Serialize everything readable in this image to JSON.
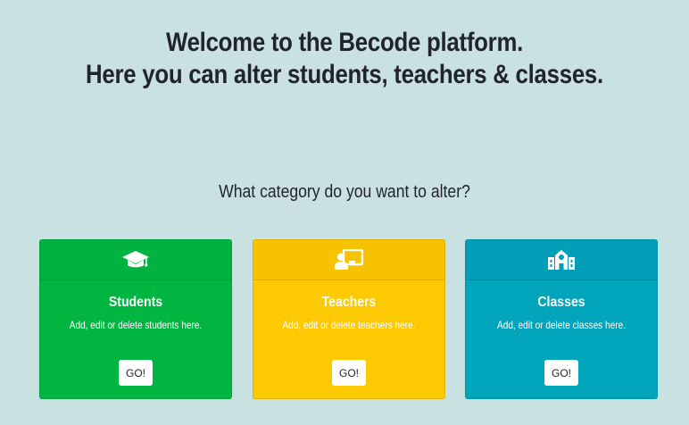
{
  "heading": {
    "line1": "Welcome to the Becode platform.",
    "line2": "Here you can alter students, teachers & classes."
  },
  "question": "What category do you want to alter?",
  "cards": [
    {
      "icon": "graduation-cap-icon",
      "title": "Students",
      "text": "Add, edit or delete students here.",
      "button": "GO!",
      "color": "#00b641"
    },
    {
      "icon": "chalkboard-teacher-icon",
      "title": "Teachers",
      "text": "Add, edit or delete teachers here.",
      "button": "GO!",
      "color": "#fdc902"
    },
    {
      "icon": "school-icon",
      "title": "Classes",
      "text": "Add, edit or delete classes here.",
      "button": "GO!",
      "color": "#00a5bc"
    }
  ],
  "colors": {
    "background": "#c9e2e1",
    "text": "#212529"
  }
}
